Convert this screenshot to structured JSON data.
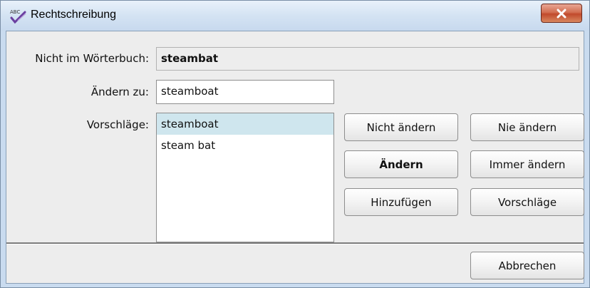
{
  "window": {
    "title": "Rechtschreibung",
    "icon": "spellcheck-abc-icon",
    "close_icon": "close-x-icon",
    "close_glyph": "✕"
  },
  "form": {
    "not_in_dict_label": "Nicht im Wörterbuch:",
    "not_in_dict_value": "steambat",
    "change_to_label": "Ändern zu:",
    "change_to_value": "steamboat",
    "suggestions_label": "Vorschläge:",
    "suggestions": [
      {
        "text": "steamboat",
        "selected": true
      },
      {
        "text": "steam bat",
        "selected": false
      }
    ]
  },
  "buttons": {
    "ignore": "Nicht ändern",
    "ignore_all": "Nie ändern",
    "change": "Ändern",
    "change_all": "Immer ändern",
    "add": "Hinzufügen",
    "suggest": "Vorschläge",
    "cancel": "Abbrechen"
  },
  "colors": {
    "selection": "#cfe6ee",
    "close_button": "#c14a2c"
  }
}
